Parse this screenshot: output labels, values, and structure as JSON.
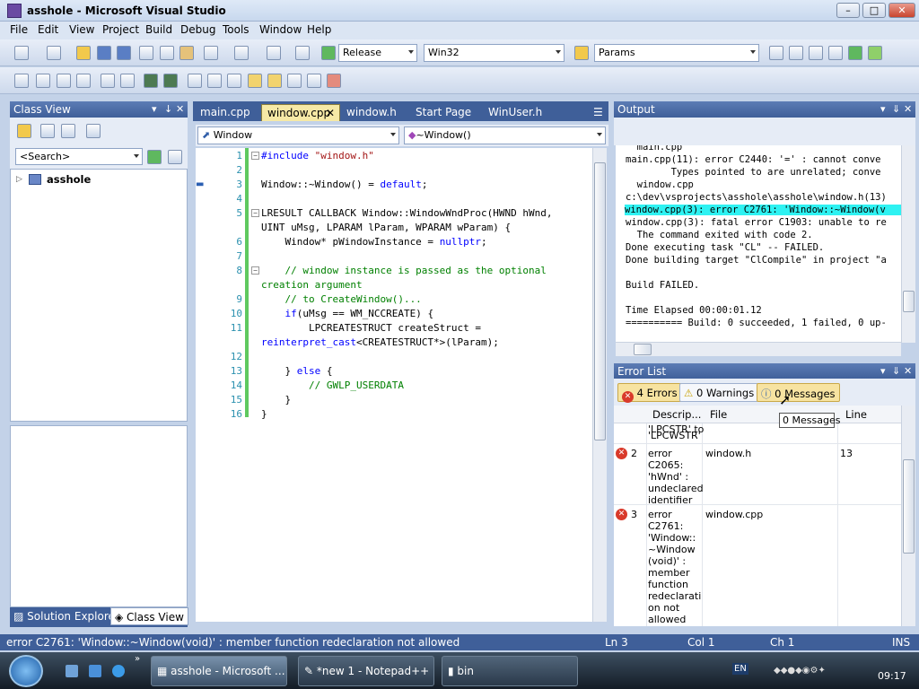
{
  "window": {
    "title": "asshole - Microsoft Visual Studio",
    "min": "–",
    "max": "□",
    "close": "✕"
  },
  "menu": [
    "File",
    "Edit",
    "View",
    "Project",
    "Build",
    "Debug",
    "Tools",
    "Window",
    "Help"
  ],
  "toolbar": {
    "configuration": "Release",
    "platform": "Win32",
    "find": "Params"
  },
  "classview": {
    "title": "Class View",
    "search_placeholder": "<Search>",
    "tree_root": "asshole",
    "tabs": [
      "Solution Explorer",
      "Class View"
    ],
    "pin": "↓",
    "close": "✕"
  },
  "editor": {
    "tabs": [
      "main.cpp",
      "window.cpp",
      "window.h",
      "Start Page",
      "WinUser.h"
    ],
    "active_tab_close": "✕",
    "nav_left": "Window",
    "nav_right": "~Window()",
    "lines": [
      {
        "n": "1",
        "parts": [
          {
            "t": "#include ",
            "c": "kw"
          },
          {
            "t": "\"window.h\"",
            "c": "str"
          }
        ]
      },
      {
        "n": "2",
        "parts": []
      },
      {
        "n": "3",
        "parts": [
          {
            "t": "Window::~Window() = ",
            "c": ""
          },
          {
            "t": "default",
            "c": "kw"
          },
          {
            "t": ";",
            "c": ""
          }
        ]
      },
      {
        "n": "4",
        "parts": []
      },
      {
        "n": "5",
        "parts": [
          {
            "t": "LRESULT CALLBACK Window::WindowWndProc(HWND hWnd,",
            "c": ""
          }
        ]
      },
      {
        "n": "",
        "parts": [
          {
            "t": "UINT uMsg, LPARAM lParam, WPARAM wParam) {",
            "c": ""
          }
        ]
      },
      {
        "n": "6",
        "parts": [
          {
            "t": "    Window* pWindowInstance = ",
            "c": ""
          },
          {
            "t": "nullptr",
            "c": "kw"
          },
          {
            "t": ";",
            "c": ""
          }
        ]
      },
      {
        "n": "7",
        "parts": []
      },
      {
        "n": "8",
        "parts": [
          {
            "t": "    // window instance is passed as the optional",
            "c": "cm"
          }
        ]
      },
      {
        "n": "",
        "parts": [
          {
            "t": "creation argument",
            "c": "cm"
          }
        ]
      },
      {
        "n": "9",
        "parts": [
          {
            "t": "    // to CreateWindow()...",
            "c": "cm"
          }
        ]
      },
      {
        "n": "10",
        "parts": [
          {
            "t": "    ",
            "c": ""
          },
          {
            "t": "if",
            "c": "kw"
          },
          {
            "t": "(uMsg == WM_NCCREATE) {",
            "c": ""
          }
        ]
      },
      {
        "n": "11",
        "parts": [
          {
            "t": "        LPCREATESTRUCT createStruct =",
            "c": ""
          }
        ]
      },
      {
        "n": "",
        "parts": [
          {
            "t": "reinterpret_cast",
            "c": "kw"
          },
          {
            "t": "<CREATESTRUCT*>(lParam);",
            "c": ""
          }
        ]
      },
      {
        "n": "12",
        "parts": []
      },
      {
        "n": "13",
        "parts": [
          {
            "t": "    } ",
            "c": ""
          },
          {
            "t": "else",
            "c": "kw"
          },
          {
            "t": " {",
            "c": ""
          }
        ]
      },
      {
        "n": "14",
        "parts": [
          {
            "t": "        // GWLP_USERDATA",
            "c": "cm"
          }
        ]
      },
      {
        "n": "15",
        "parts": [
          {
            "t": "    }",
            "c": ""
          }
        ]
      },
      {
        "n": "16",
        "parts": [
          {
            "t": "}",
            "c": ""
          }
        ]
      }
    ]
  },
  "output": {
    "title": "Output",
    "lines": [
      "  main.cpp",
      "main.cpp(11): error C2440: '=' : cannot conve",
      "        Types pointed to are unrelated; conve",
      "  window.cpp",
      "c:\\dev\\vsprojects\\asshole\\asshole\\window.h(13)",
      "window.cpp(3): error C2761: 'Window::~Window(v",
      "window.cpp(3): fatal error C1903: unable to re",
      "  The command exited with code 2.",
      "Done executing task \"CL\" -- FAILED.",
      "Done building target \"ClCompile\" in project \"a",
      "",
      "Build FAILED.",
      "",
      "Time Elapsed 00:00:01.12",
      "========== Build: 0 succeeded, 1 failed, 0 up-"
    ],
    "highlight_index": 5
  },
  "errorlist": {
    "title": "Error List",
    "errors_btn": "4 Errors",
    "warnings_btn": "0 Warnings",
    "messages_btn": "0 Messages",
    "tooltip": "0 Messages",
    "columns": [
      "Descrip...",
      "File",
      "Line"
    ],
    "partial_top": [
      "'LPCSTR' to",
      "'LPCWSTR'"
    ],
    "rows": [
      {
        "num": "2",
        "desc": [
          "error",
          "C2065:",
          "'hWnd' :",
          "undeclared",
          "identifier"
        ],
        "file": "window.h",
        "line": "13"
      },
      {
        "num": "3",
        "desc": [
          "error",
          "C2761:",
          "'Window::",
          "~Window",
          "(void)' :",
          "member",
          "function",
          "redeclarati",
          "on not",
          "allowed"
        ],
        "file": "window.cpp",
        "line": ""
      }
    ]
  },
  "status": {
    "message": "error C2761: 'Window::~Window(void)' : member function redeclaration not allowed",
    "ln": "Ln 3",
    "col": "Col 1",
    "ch": "Ch 1",
    "mode": "INS"
  },
  "taskbar": {
    "items": [
      "asshole - Microsoft ...",
      "*new 1 - Notepad++",
      "bin"
    ],
    "lang": "EN",
    "time": "09:17"
  }
}
